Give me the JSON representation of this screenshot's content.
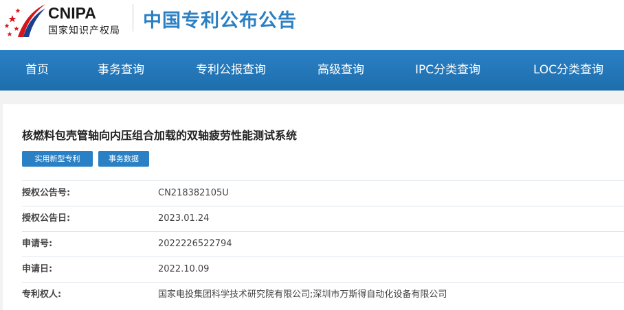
{
  "header": {
    "logo_en": "CNIPA",
    "logo_cn": "国家知识产权局",
    "site_title": "中国专利公布公告",
    "emblem_colors": {
      "red": "#d7141c",
      "blue": "#1b3f8f"
    }
  },
  "nav": {
    "items": [
      {
        "label": "首页"
      },
      {
        "label": "事务查询"
      },
      {
        "label": "专利公报查询"
      },
      {
        "label": "高级查询"
      },
      {
        "label": "IPC分类查询"
      },
      {
        "label": "LOC分类查询"
      }
    ],
    "background": "#2a80c4"
  },
  "document": {
    "title": "核燃料包壳管轴向内压组合加载的双轴疲劳性能测试系统",
    "tags": [
      "实用新型专利",
      "事务数据"
    ],
    "fields": [
      {
        "label": "授权公告号:",
        "value": "CN218382105U"
      },
      {
        "label": "授权公告日:",
        "value": "2023.01.24"
      },
      {
        "label": "申请号:",
        "value": "2022226522794"
      },
      {
        "label": "申请日:",
        "value": "2022.10.09"
      },
      {
        "label": "专利权人:",
        "value": "国家电投集团科学技术研究院有限公司;深圳市万斯得自动化设备有限公司"
      }
    ]
  }
}
